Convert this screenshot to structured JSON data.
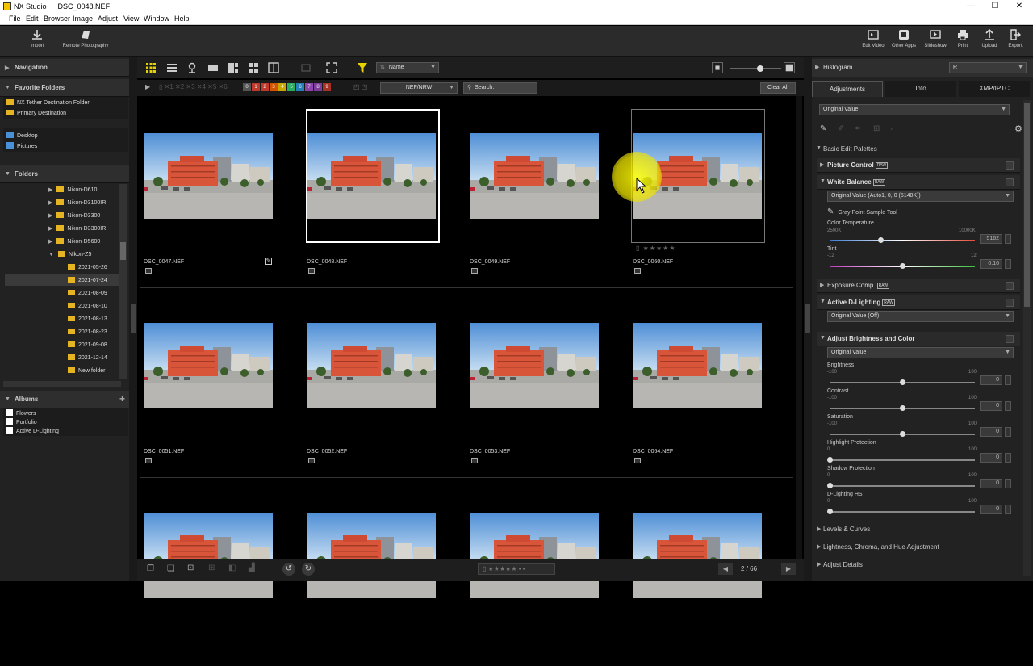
{
  "window": {
    "title": "NX Studio",
    "file": "DSC_0048.NEF"
  },
  "menu": [
    "File",
    "Edit",
    "Browser",
    "Image",
    "Adjust",
    "View",
    "Window",
    "Help"
  ],
  "toolbar": {
    "left": [
      {
        "label": "Import",
        "icon": "import-icon"
      },
      {
        "label": "Remote Photography",
        "icon": "camera-icon"
      }
    ],
    "right": [
      {
        "label": "Edit Video",
        "icon": "film-icon"
      },
      {
        "label": "Other Apps",
        "icon": "apps-icon"
      },
      {
        "label": "Slideshow",
        "icon": "slideshow-icon"
      },
      {
        "label": "Print",
        "icon": "print-icon"
      },
      {
        "label": "Upload",
        "icon": "upload-icon"
      },
      {
        "label": "Export",
        "icon": "export-icon"
      }
    ]
  },
  "left_panel": {
    "navigation": "Navigation",
    "favorite_folders": "Favorite Folders",
    "favorites": [
      "NX Tether Destination Folder",
      "Primary Destination"
    ],
    "places": [
      "Desktop",
      "Pictures"
    ],
    "folders_title": "Folders",
    "camera_folders": [
      "Nikon-D610",
      "Nikon-D3100IR",
      "Nikon-D3300",
      "Nikon-D3300IR",
      "Nikon-D5600",
      "Nikon-Z5"
    ],
    "date_folders": [
      "2021-05-26",
      "2021-07-24",
      "2021-08-09",
      "2021-08-10",
      "2021-08-13",
      "2021-08-23",
      "2021-09-08",
      "2021-12-14",
      "New folder"
    ],
    "selected_folder": "2021-07-24",
    "albums_title": "Albums",
    "albums": [
      "Flowers",
      "Portfolio",
      "Active D-Lighting"
    ]
  },
  "browser": {
    "sort_label": "Name",
    "filter_type": "NEF/NRW",
    "search_placeholder": "Search:",
    "clear_all": "Clear All",
    "label_numbers": [
      "0",
      "1",
      "2",
      "3",
      "4",
      "5",
      "6",
      "7",
      "8",
      "9"
    ],
    "label_colors": [
      "#555555",
      "#c0392b",
      "#c0392b",
      "#d35400",
      "#c9a800",
      "#27ae60",
      "#2980b9",
      "#8e44ad",
      "#7d3c98",
      "#a93226"
    ],
    "thumbnails": [
      {
        "name": "DSC_0047.NEF",
        "edited": true
      },
      {
        "name": "DSC_0048.NEF",
        "selected": true
      },
      {
        "name": "DSC_0049.NEF"
      },
      {
        "name": "DSC_0050.NEF",
        "hover": true
      },
      {
        "name": "DSC_0051.NEF"
      },
      {
        "name": "DSC_0052.NEF"
      },
      {
        "name": "DSC_0053.NEF"
      },
      {
        "name": "DSC_0054.NEF"
      },
      {
        "name": ""
      },
      {
        "name": ""
      },
      {
        "name": ""
      },
      {
        "name": ""
      }
    ],
    "page_indicator": "2 / 66"
  },
  "right_panel": {
    "histogram": "Histogram",
    "histogram_channel": "R",
    "tabs": [
      "Adjustments",
      "Info",
      "XMP/IPTC"
    ],
    "active_tab": "Adjustments",
    "preset": "Original Value",
    "basic_edit": "Basic Edit Palettes",
    "picture_control": "Picture Control",
    "white_balance": "White Balance",
    "wb_value": "Original Value (Auto1, 0, 0 (5140K))",
    "gray_point": "Gray Point Sample Tool",
    "color_temperature": {
      "label": "Color Temperature",
      "min": "2500K",
      "max": "10000K",
      "value": "5162",
      "fraction": 0.35
    },
    "tint": {
      "label": "Tint",
      "min": "-12",
      "max": "12",
      "value": "0.16",
      "fraction": 0.5
    },
    "exposure_comp": "Exposure Comp.",
    "active_dlighting": "Active D-Lighting",
    "adl_value": "Original Value (Off)",
    "adjust_brightness": "Adjust Brightness and Color",
    "abc_value": "Original Value",
    "sliders": [
      {
        "label": "Brightness",
        "min": "-100",
        "max": "100",
        "value": "0",
        "fraction": 0.5
      },
      {
        "label": "Contrast",
        "min": "-100",
        "max": "100",
        "value": "0",
        "fraction": 0.5
      },
      {
        "label": "Saturation",
        "min": "-100",
        "max": "100",
        "value": "0",
        "fraction": 0.5
      },
      {
        "label": "Highlight Protection",
        "min": "0",
        "max": "100",
        "value": "0",
        "fraction": 0.0
      },
      {
        "label": "Shadow Protection",
        "min": "0",
        "max": "100",
        "value": "0",
        "fraction": 0.0
      },
      {
        "label": "D-Lighting HS",
        "min": "0",
        "max": "100",
        "value": "0",
        "fraction": 0.0
      }
    ],
    "collapsed": [
      "Levels & Curves",
      "Lightness, Chroma, and Hue Adjustment",
      "Adjust Details"
    ]
  }
}
